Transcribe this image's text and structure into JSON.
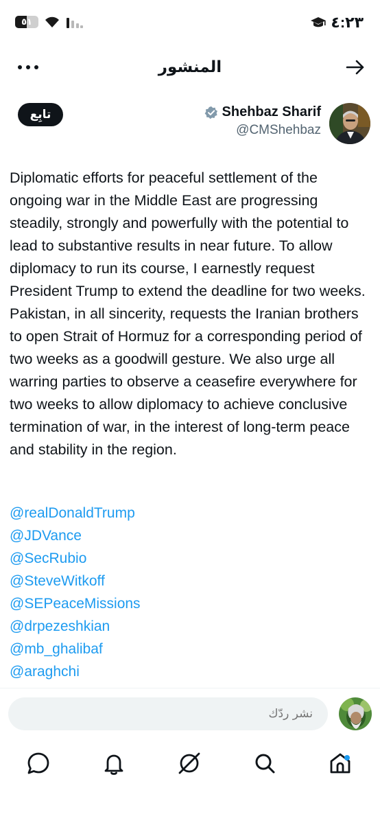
{
  "status_bar": {
    "time": "٤:٢٣",
    "battery_label": "٥١",
    "battery_level": 0.51,
    "icons": [
      "battery-icon",
      "wifi-icon",
      "signal-icon",
      "graduation-cap-icon"
    ]
  },
  "header": {
    "title": "المنشور",
    "more_icon": "more-dots-icon",
    "back_icon": "arrow-right-icon"
  },
  "author": {
    "name": "Shehbaz Sharif",
    "handle": "@CMShehbaz",
    "verified_icon": "verified-badge-icon",
    "follow_label": "تابِع"
  },
  "post": {
    "text": "Diplomatic efforts for peaceful settlement of the ongoing war in the Middle East are progressing steadily, strongly and powerfully with the potential to lead to substantive results in near future. To allow diplomacy to run its course, I earnestly request President Trump to extend the deadline for two weeks. Pakistan, in all sincerity, requests the Iranian brothers to open Strait of Hormuz for a corresponding period of two weeks as a goodwill gesture. We also urge all warring parties to observe a ceasefire everywhere for two weeks to allow diplomacy to achieve conclusive termination of war, in the interest of long-term peace and stability in the region.",
    "mentions": [
      "@realDonaldTrump",
      "@JDVance",
      "@SecRubio",
      "@SteveWitkoff",
      "@SEPeaceMissions",
      "@drpezeshkian",
      "@mb_ghalibaf",
      "@araghchi"
    ]
  },
  "reply": {
    "placeholder": "نشر ردّك"
  },
  "bottom_nav": {
    "items": [
      "messages-icon",
      "notifications-icon",
      "grok-icon",
      "search-icon",
      "home-icon"
    ]
  },
  "colors": {
    "text": "#0f1419",
    "secondary": "#536471",
    "link": "#1d9bf0",
    "verified": "#829aab",
    "input_bg": "#eff3f4"
  }
}
